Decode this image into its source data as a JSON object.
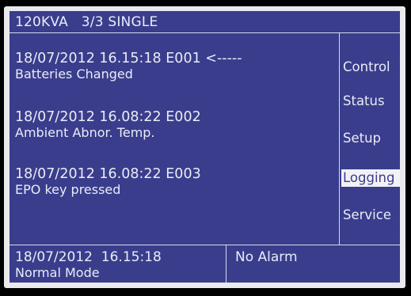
{
  "header": {
    "title": "120KVA   3/3 SINGLE"
  },
  "log": {
    "entries": [
      {
        "datetime_code": "18/07/2012 16.15:18 E001 <-----",
        "description": "Batteries Changed"
      },
      {
        "datetime_code": "18/07/2012 16.08:22 E002",
        "description": "Ambient Abnor. Temp."
      },
      {
        "datetime_code": "18/07/2012 16.08:22 E003",
        "description": "EPO key pressed"
      }
    ]
  },
  "menu": {
    "items": [
      {
        "label": "Control"
      },
      {
        "label": "Status"
      },
      {
        "label": "Setup"
      },
      {
        "label": "Logging"
      },
      {
        "label": "Service"
      }
    ],
    "selected": "Logging"
  },
  "statusbar": {
    "datetime": "18/07/2012  16.15:18",
    "mode": "Normal Mode",
    "alarm": "No Alarm"
  },
  "colors": {
    "screen_bg": "#3a3d8c",
    "text": "#e9ecf6",
    "selected_bg": "#f2f2f6",
    "frame": "#e9e9ee"
  }
}
